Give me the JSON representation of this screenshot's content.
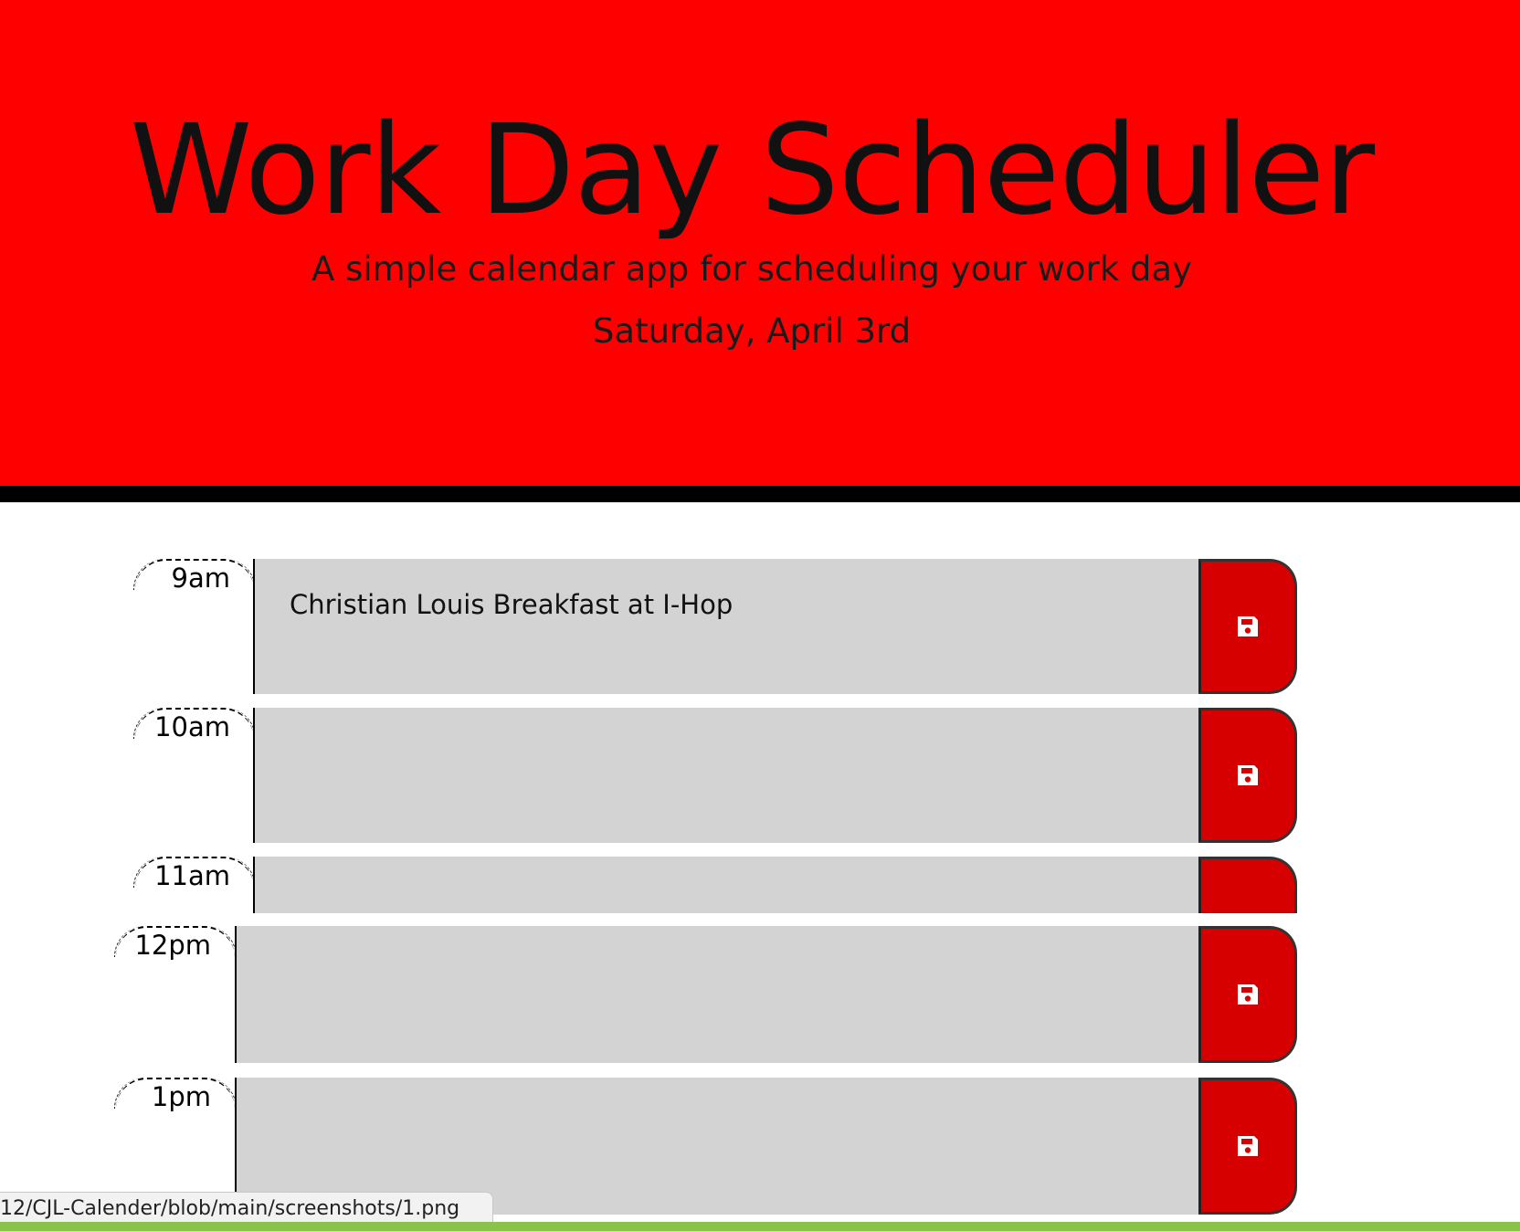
{
  "header": {
    "title": "Work Day Scheduler",
    "subtitle": "A simple calendar app for scheduling your work day",
    "date": "Saturday, April 3rd"
  },
  "rows": [
    {
      "hour": "9am",
      "text": "Christian Louis Breakfast at I-Hop"
    },
    {
      "hour": "10am",
      "text": ""
    },
    {
      "hour": "11am",
      "text": ""
    },
    {
      "hour": "12pm",
      "text": ""
    },
    {
      "hour": "1pm",
      "text": ""
    }
  ],
  "save_icon": "floppy-disk-icon",
  "status_bar": {
    "url": "12/CJL-Calender/blob/main/screenshots/1.png"
  },
  "colors": {
    "header_bg": "#ff0000",
    "row_bg": "#d3d3d3",
    "save_bg": "#d70000",
    "bottom_bar": "#8bc34a"
  }
}
